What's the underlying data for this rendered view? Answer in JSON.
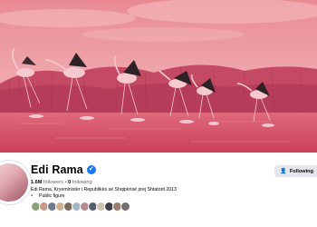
{
  "profile": {
    "name": "Edi Rama",
    "followers_count": "1.6M",
    "followers_label": "followers",
    "following_count": "0",
    "following_label": "following",
    "separator": " • ",
    "bio": "Edi Rama, Kryeministër i Republikës së Shqipërisë prej Shtatorit 2013",
    "category": "Public figure",
    "verified_icon": "✔",
    "category_icon": "▪"
  },
  "actions": {
    "following_label": "Following",
    "following_icon": "👤"
  },
  "friend_avatar_colors": [
    "#8aa37b",
    "#c79a8a",
    "#6f7b8c",
    "#d4b08c",
    "#7d6a5a",
    "#a6b3c4",
    "#b58a93",
    "#55606e",
    "#cfc3b0",
    "#3f3f46",
    "#9c7f6b",
    "#707070"
  ],
  "colors": {
    "accent": "#1877f2",
    "cover_sky_top": "#e58a93",
    "cover_water": "#d9536b",
    "button_bg": "#e4e6eb"
  }
}
